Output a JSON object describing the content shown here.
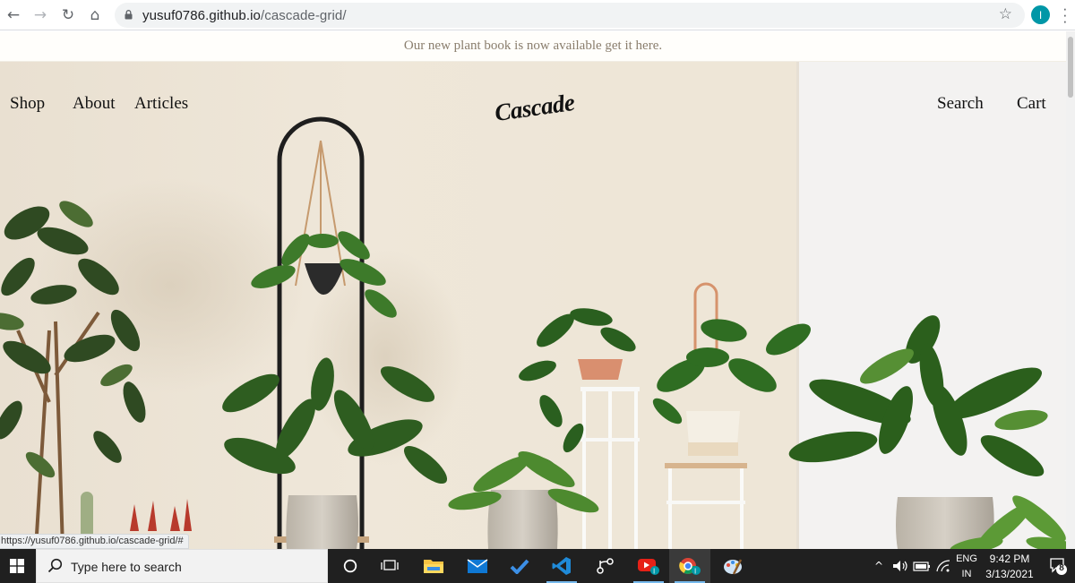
{
  "browser": {
    "url_host": "yusuf0786.github.io",
    "url_path": "/cascade-grid/",
    "profile_initial": "I",
    "icons": [
      "back-arrow-icon",
      "forward-arrow-icon",
      "reload-icon",
      "home-icon",
      "lock-icon",
      "star-icon",
      "kebab-menu-icon"
    ]
  },
  "page": {
    "announcement": "Our new plant book is now available get it here.",
    "nav_left": [
      "Shop",
      "About",
      "Articles"
    ],
    "logo": "Cascade",
    "nav_right": [
      "Search",
      "Cart"
    ],
    "status_url": "https://yusuf0786.github.io/cascade-grid/#"
  },
  "taskbar": {
    "search_placeholder": "Type here to search",
    "apps": [
      "cortana-icon",
      "task-view-icon",
      "file-explorer-icon",
      "mail-icon",
      "todo-icon",
      "vscode-icon",
      "git-icon",
      "youtube-icon",
      "chrome-icon",
      "paint-icon"
    ],
    "lang_line1": "ENG",
    "lang_line2": "IN",
    "time": "9:42 PM",
    "date": "3/13/2021",
    "notification_count": "8"
  },
  "colors": {
    "hero_bg": "#efe8db",
    "wall_right": "#f4f3f2",
    "announce_text": "#8a7e6d",
    "taskbar": "#202020"
  }
}
